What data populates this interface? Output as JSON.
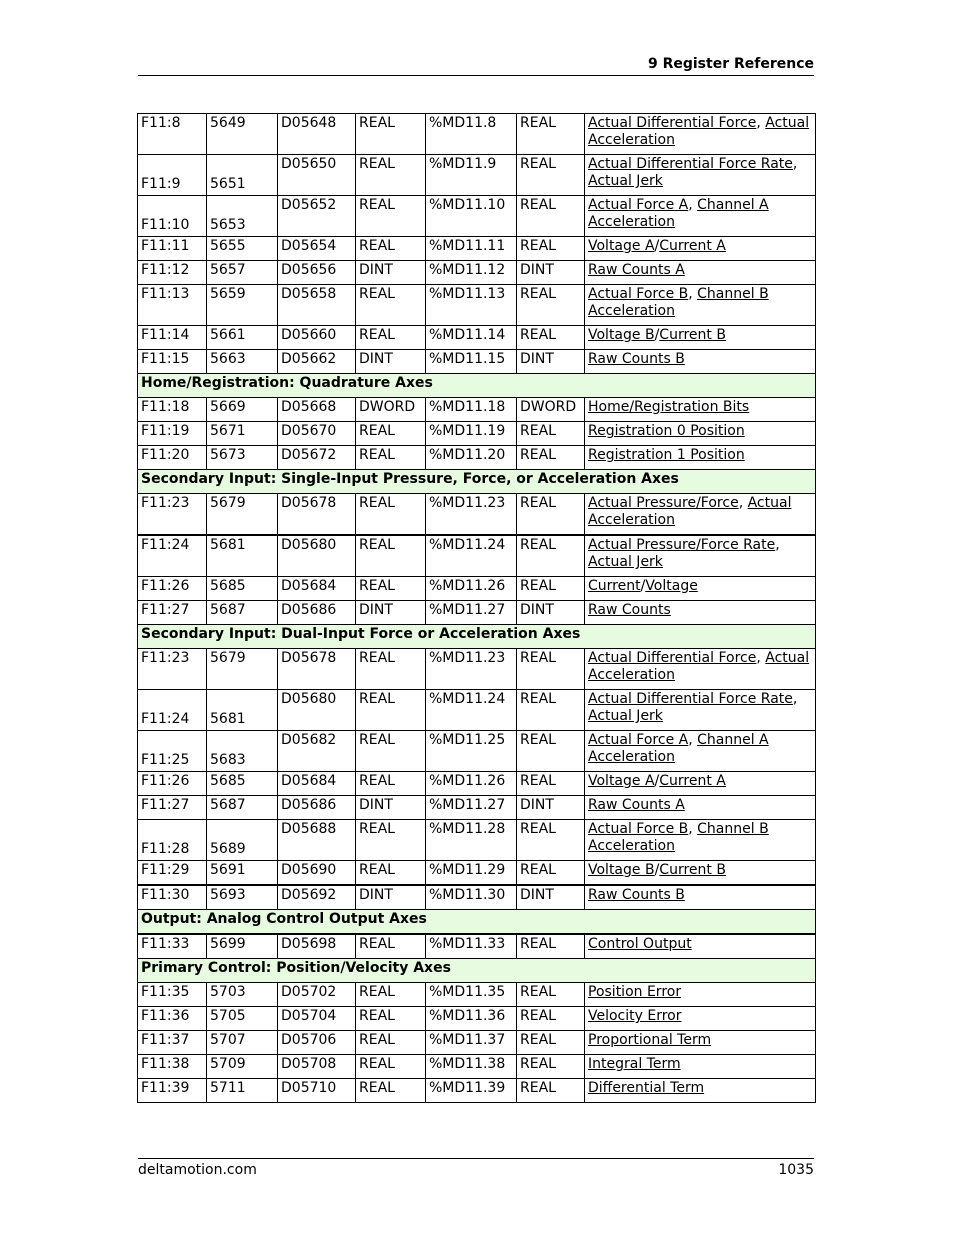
{
  "header": {
    "title": "9  Register Reference"
  },
  "footer": {
    "site": "deltamotion.com",
    "page": "1035"
  },
  "rows": [
    {
      "type": "data",
      "tall": true,
      "low": false,
      "c": [
        "F11:8",
        "5649",
        "D05648",
        "REAL",
        "%MD11.8",
        "REAL"
      ],
      "desc": [
        [
          "Actual Differential Force",
          true
        ],
        [
          ", ",
          false
        ],
        [
          "Actual Acceleration",
          true
        ]
      ]
    },
    {
      "type": "data",
      "tall": true,
      "low": true,
      "c": [
        "F11:9",
        "5651",
        "D05650",
        "REAL",
        "%MD11.9",
        "REAL"
      ],
      "desc": [
        [
          "Actual Differential Force Rate",
          true
        ],
        [
          ", ",
          false
        ],
        [
          "Actual Jerk",
          true
        ]
      ]
    },
    {
      "type": "data",
      "tall": true,
      "low": true,
      "c": [
        "F11:10",
        "5653",
        "D05652",
        "REAL",
        "%MD11.10",
        "REAL"
      ],
      "desc": [
        [
          "Actual Force A",
          true
        ],
        [
          ", ",
          false
        ],
        [
          "Channel A Acceleration",
          true
        ]
      ]
    },
    {
      "type": "data",
      "c": [
        "F11:11",
        "5655",
        "D05654",
        "REAL",
        "%MD11.11",
        "REAL"
      ],
      "desc": [
        [
          "Voltage A",
          true
        ],
        [
          "/",
          false
        ],
        [
          "Current A",
          true
        ]
      ]
    },
    {
      "type": "data",
      "c": [
        "F11:12",
        "5657",
        "D05656",
        "DINT",
        "%MD11.12",
        "DINT"
      ],
      "desc": [
        [
          "Raw Counts A",
          true
        ]
      ]
    },
    {
      "type": "data",
      "tall": true,
      "c": [
        "F11:13",
        "5659",
        "D05658",
        "REAL",
        "%MD11.13",
        "REAL"
      ],
      "desc": [
        [
          "Actual Force B",
          true
        ],
        [
          ", ",
          false
        ],
        [
          "Channel B Acceleration",
          true
        ]
      ]
    },
    {
      "type": "data",
      "c": [
        "F11:14",
        "5661",
        "D05660",
        "REAL",
        "%MD11.14",
        "REAL"
      ],
      "desc": [
        [
          "Voltage B",
          true
        ],
        [
          "/",
          false
        ],
        [
          "Current B",
          true
        ]
      ]
    },
    {
      "type": "data",
      "c": [
        "F11:15",
        "5663",
        "D05662",
        "DINT",
        "%MD11.15",
        "DINT"
      ],
      "desc": [
        [
          "Raw Counts B",
          true
        ]
      ]
    },
    {
      "type": "section",
      "label": "Home/Registration: Quadrature Axes"
    },
    {
      "type": "data",
      "c": [
        "F11:18",
        "5669",
        "D05668",
        "DWORD",
        "%MD11.18",
        "DWORD"
      ],
      "desc": [
        [
          "Home/Registration Bits",
          true
        ]
      ]
    },
    {
      "type": "data",
      "c": [
        "F11:19",
        "5671",
        "D05670",
        "REAL",
        "%MD11.19",
        "REAL"
      ],
      "desc": [
        [
          "Registration 0 Position",
          true
        ]
      ]
    },
    {
      "type": "data",
      "c": [
        "F11:20",
        "5673",
        "D05672",
        "REAL",
        "%MD11.20",
        "REAL"
      ],
      "desc": [
        [
          "Registration 1 Position",
          true
        ]
      ]
    },
    {
      "type": "section",
      "label": "Secondary Input: Single-Input Pressure, Force, or Acceleration Axes"
    },
    {
      "type": "data",
      "tall": true,
      "thick": true,
      "c": [
        "F11:23",
        "5679",
        "D05678",
        "REAL",
        "%MD11.23",
        "REAL"
      ],
      "desc": [
        [
          "Actual Pressure/Force",
          true
        ],
        [
          ", ",
          false
        ],
        [
          "Actual Acceleration",
          true
        ]
      ]
    },
    {
      "type": "data",
      "tall": true,
      "c": [
        "F11:24",
        "5681",
        "D05680",
        "REAL",
        "%MD11.24",
        "REAL"
      ],
      "desc": [
        [
          "Actual Pressure/Force Rate",
          true
        ],
        [
          ", ",
          false
        ],
        [
          "Actual Jerk",
          true
        ]
      ]
    },
    {
      "type": "data",
      "c": [
        "F11:26",
        "5685",
        "D05684",
        "REAL",
        "%MD11.26",
        "REAL"
      ],
      "desc": [
        [
          "Current",
          true
        ],
        [
          "/",
          false
        ],
        [
          "Voltage",
          true
        ]
      ]
    },
    {
      "type": "data",
      "c": [
        "F11:27",
        "5687",
        "D05686",
        "DINT",
        "%MD11.27",
        "DINT"
      ],
      "desc": [
        [
          "Raw Counts",
          true
        ]
      ]
    },
    {
      "type": "section",
      "label": "Secondary Input: Dual-Input Force or Acceleration Axes"
    },
    {
      "type": "data",
      "tall": true,
      "c": [
        "F11:23",
        "5679",
        "D05678",
        "REAL",
        "%MD11.23",
        "REAL"
      ],
      "desc": [
        [
          "Actual Differential Force",
          true
        ],
        [
          ", ",
          false
        ],
        [
          "Actual Acceleration",
          true
        ]
      ]
    },
    {
      "type": "data",
      "tall": true,
      "low": true,
      "c": [
        "F11:24",
        "5681",
        "D05680",
        "REAL",
        "%MD11.24",
        "REAL"
      ],
      "desc": [
        [
          "Actual Differential Force Rate",
          true
        ],
        [
          ", ",
          false
        ],
        [
          "Actual Jerk",
          true
        ]
      ]
    },
    {
      "type": "data",
      "tall": true,
      "low": true,
      "c": [
        "F11:25",
        "5683",
        "D05682",
        "REAL",
        "%MD11.25",
        "REAL"
      ],
      "desc": [
        [
          "Actual Force A",
          true
        ],
        [
          ", ",
          false
        ],
        [
          "Channel A Acceleration",
          true
        ]
      ]
    },
    {
      "type": "data",
      "c": [
        "F11:26",
        "5685",
        "D05684",
        "REAL",
        "%MD11.26",
        "REAL"
      ],
      "desc": [
        [
          "Voltage A",
          true
        ],
        [
          "/",
          false
        ],
        [
          "Current A",
          true
        ]
      ]
    },
    {
      "type": "data",
      "c": [
        "F11:27",
        "5687",
        "D05686",
        "DINT",
        "%MD11.27",
        "DINT"
      ],
      "desc": [
        [
          "Raw Counts A",
          true
        ]
      ]
    },
    {
      "type": "data",
      "tall": true,
      "low": true,
      "c": [
        "F11:28",
        "5689",
        "D05688",
        "REAL",
        "%MD11.28",
        "REAL"
      ],
      "desc": [
        [
          "Actual Force B",
          true
        ],
        [
          ", ",
          false
        ],
        [
          "Channel B Acceleration",
          true
        ]
      ]
    },
    {
      "type": "data",
      "thick": true,
      "c": [
        "F11:29",
        "5691",
        "D05690",
        "REAL",
        "%MD11.29",
        "REAL"
      ],
      "desc": [
        [
          "Voltage B",
          true
        ],
        [
          "/",
          false
        ],
        [
          "Current B",
          true
        ]
      ]
    },
    {
      "type": "data",
      "c": [
        "F11:30",
        "5693",
        "D05692",
        "DINT",
        "%MD11.30",
        "DINT"
      ],
      "desc": [
        [
          "Raw Counts B",
          true
        ]
      ]
    },
    {
      "type": "section",
      "label": "Output: Analog Control Output Axes",
      "thick": true
    },
    {
      "type": "data",
      "c": [
        "F11:33",
        "5699",
        "D05698",
        "REAL",
        "%MD11.33",
        "REAL"
      ],
      "desc": [
        [
          "Control Output",
          true
        ]
      ]
    },
    {
      "type": "section",
      "label": "Primary Control: Position/Velocity Axes"
    },
    {
      "type": "data",
      "c": [
        "F11:35",
        "5703",
        "D05702",
        "REAL",
        "%MD11.35",
        "REAL"
      ],
      "desc": [
        [
          "Position Error",
          true
        ]
      ]
    },
    {
      "type": "data",
      "c": [
        "F11:36",
        "5705",
        "D05704",
        "REAL",
        "%MD11.36",
        "REAL"
      ],
      "desc": [
        [
          "Velocity Error",
          true
        ]
      ]
    },
    {
      "type": "data",
      "c": [
        "F11:37",
        "5707",
        "D05706",
        "REAL",
        "%MD11.37",
        "REAL"
      ],
      "desc": [
        [
          "Proportional Term",
          true
        ]
      ]
    },
    {
      "type": "data",
      "c": [
        "F11:38",
        "5709",
        "D05708",
        "REAL",
        "%MD11.38",
        "REAL"
      ],
      "desc": [
        [
          "Integral Term",
          true
        ]
      ]
    },
    {
      "type": "data",
      "c": [
        "F11:39",
        "5711",
        "D05710",
        "REAL",
        "%MD11.39",
        "REAL"
      ],
      "desc": [
        [
          "Differential Term",
          true
        ]
      ]
    }
  ]
}
